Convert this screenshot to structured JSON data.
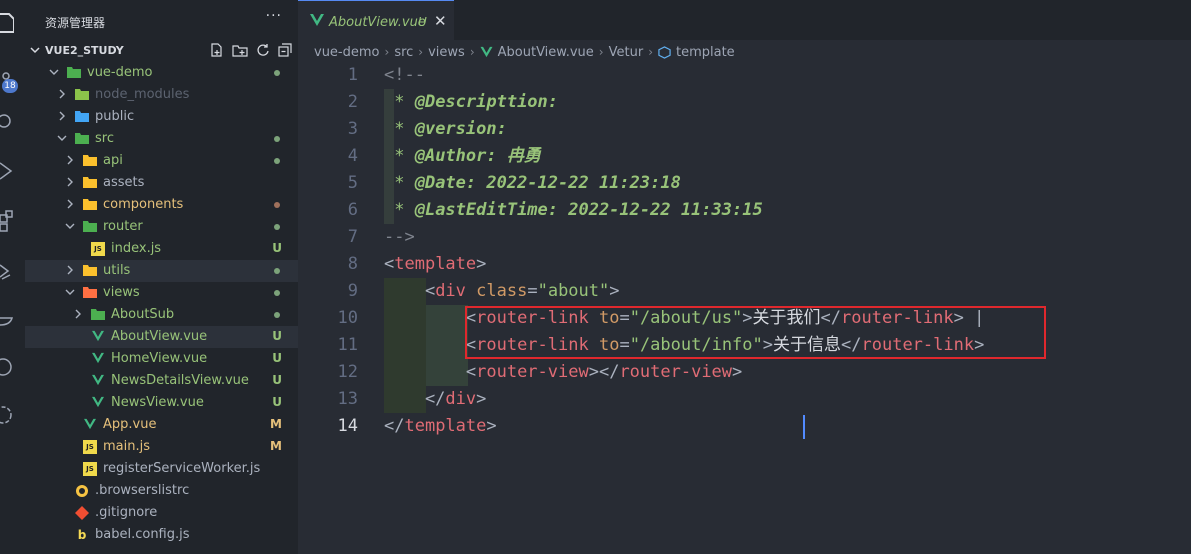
{
  "activity_bar": {
    "icons": [
      "explorer-icon",
      "source-control-icon",
      "search-icon",
      "run-debug-icon",
      "extensions-icon",
      "remote-icon",
      "docker-icon",
      "git-graph-icon",
      "openai-icon"
    ],
    "badge": "18"
  },
  "sidebar": {
    "title": "资源管理器",
    "more": "···",
    "section": "VUE2_STUDY",
    "tree": [
      {
        "label": "vue-demo",
        "type": "folder",
        "open": true,
        "depth": 0,
        "status": "",
        "dot": "#7ca37a",
        "color": "#98c379"
      },
      {
        "label": "node_modules",
        "type": "folder",
        "open": false,
        "depth": 1,
        "status": "",
        "dot": "",
        "color": "#5c6370"
      },
      {
        "label": "public",
        "type": "folder",
        "open": false,
        "depth": 1,
        "status": "",
        "dot": "",
        "color": "#abb2bf"
      },
      {
        "label": "src",
        "type": "folder",
        "open": true,
        "depth": 1,
        "status": "",
        "dot": "#7ca37a",
        "color": "#98c379"
      },
      {
        "label": "api",
        "type": "folder",
        "open": false,
        "depth": 2,
        "status": "",
        "dot": "#7ca37a",
        "color": "#98c379"
      },
      {
        "label": "assets",
        "type": "folder",
        "open": false,
        "depth": 2,
        "status": "",
        "dot": "",
        "color": "#abb2bf"
      },
      {
        "label": "components",
        "type": "folder",
        "open": false,
        "depth": 2,
        "status": "",
        "dot": "#a0715c",
        "color": "#e5c07b"
      },
      {
        "label": "router",
        "type": "folder",
        "open": true,
        "depth": 2,
        "status": "",
        "dot": "#7ca37a",
        "color": "#98c379"
      },
      {
        "label": "index.js",
        "type": "js",
        "open": false,
        "depth": 3,
        "status": "U",
        "dot": "",
        "color": "#98c379"
      },
      {
        "label": "utils",
        "type": "folder",
        "open": false,
        "depth": 2,
        "status": "",
        "dot": "#7ca37a",
        "color": "#98c379"
      },
      {
        "label": "views",
        "type": "folder",
        "open": true,
        "depth": 2,
        "status": "",
        "dot": "#7ca37a",
        "color": "#98c379"
      },
      {
        "label": "AboutSub",
        "type": "folder",
        "open": false,
        "depth": 3,
        "status": "",
        "dot": "#7ca37a",
        "color": "#98c379"
      },
      {
        "label": "AboutView.vue",
        "type": "vue",
        "open": false,
        "depth": 3,
        "status": "U",
        "dot": "",
        "color": "#98c379"
      },
      {
        "label": "HomeView.vue",
        "type": "vue",
        "open": false,
        "depth": 3,
        "status": "U",
        "dot": "",
        "color": "#98c379"
      },
      {
        "label": "NewsDetailsView.vue",
        "type": "vue",
        "open": false,
        "depth": 3,
        "status": "U",
        "dot": "",
        "color": "#98c379"
      },
      {
        "label": "NewsView.vue",
        "type": "vue",
        "open": false,
        "depth": 3,
        "status": "U",
        "dot": "",
        "color": "#98c379"
      },
      {
        "label": "App.vue",
        "type": "vue",
        "open": false,
        "depth": 2,
        "status": "M",
        "dot": "",
        "color": "#e5c07b"
      },
      {
        "label": "main.js",
        "type": "js",
        "open": false,
        "depth": 2,
        "status": "M",
        "dot": "",
        "color": "#e5c07b"
      },
      {
        "label": "registerServiceWorker.js",
        "type": "js",
        "open": false,
        "depth": 2,
        "status": "",
        "dot": "",
        "color": "#abb2bf"
      },
      {
        "label": ".browserslistrc",
        "type": "browserslist",
        "open": false,
        "depth": 1,
        "status": "",
        "dot": "",
        "color": "#abb2bf"
      },
      {
        "label": ".gitignore",
        "type": "git",
        "open": false,
        "depth": 1,
        "status": "",
        "dot": "",
        "color": "#abb2bf"
      },
      {
        "label": "babel.config.js",
        "type": "babel",
        "open": false,
        "depth": 1,
        "status": "",
        "dot": "",
        "color": "#abb2bf"
      }
    ]
  },
  "tab": {
    "name": "AboutView.vue",
    "status": "U",
    "close": "✕"
  },
  "breadcrumbs": [
    "vue-demo",
    "src",
    "views",
    "AboutView.vue",
    "Vetur",
    "template"
  ],
  "code_lines": [
    {
      "n": "1",
      "tokens": [
        [
          "cm",
          "<!--"
        ]
      ]
    },
    {
      "n": "2",
      "tokens": [
        [
          "cmg",
          " * "
        ],
        [
          "cmb",
          "@Descripttion:"
        ]
      ]
    },
    {
      "n": "3",
      "tokens": [
        [
          "cmg",
          " * "
        ],
        [
          "cmb",
          "@version:"
        ]
      ]
    },
    {
      "n": "4",
      "tokens": [
        [
          "cmg",
          " * "
        ],
        [
          "cmb",
          "@Author: 冉勇"
        ]
      ]
    },
    {
      "n": "5",
      "tokens": [
        [
          "cmg",
          " * "
        ],
        [
          "cmb",
          "@Date: 2022-12-22 11:23:18"
        ]
      ]
    },
    {
      "n": "6",
      "tokens": [
        [
          "cmg",
          " * "
        ],
        [
          "cmb",
          "@LastEditTime: 2022-12-22 11:33:15"
        ]
      ]
    },
    {
      "n": "7",
      "tokens": [
        [
          "cm",
          "-->"
        ]
      ]
    },
    {
      "n": "8",
      "tokens": [
        [
          "punc",
          "<"
        ],
        [
          "tag",
          "template"
        ],
        [
          "punc",
          ">"
        ]
      ]
    },
    {
      "n": "9",
      "tokens": [
        [
          "punc",
          "    <"
        ],
        [
          "tag",
          "div"
        ],
        [
          "punc",
          " "
        ],
        [
          "attr",
          "class"
        ],
        [
          "punc",
          "="
        ],
        [
          "str",
          "\"about\""
        ],
        [
          "punc",
          ">"
        ]
      ]
    },
    {
      "n": "10",
      "tokens": [
        [
          "punc",
          "        <"
        ],
        [
          "tag",
          "router-link"
        ],
        [
          "punc",
          " "
        ],
        [
          "attr",
          "to"
        ],
        [
          "punc",
          "="
        ],
        [
          "str",
          "\"/about/us\""
        ],
        [
          "punc",
          ">"
        ],
        [
          "txt",
          "关于我们"
        ],
        [
          "punc",
          "</"
        ],
        [
          "tag",
          "router-link"
        ],
        [
          "punc",
          "> |"
        ]
      ]
    },
    {
      "n": "11",
      "tokens": [
        [
          "punc",
          "        <"
        ],
        [
          "tag",
          "router-link"
        ],
        [
          "punc",
          " "
        ],
        [
          "attr",
          "to"
        ],
        [
          "punc",
          "="
        ],
        [
          "str",
          "\"/about/info\""
        ],
        [
          "punc",
          ">"
        ],
        [
          "txt",
          "关于信息"
        ],
        [
          "punc",
          "</"
        ],
        [
          "tag",
          "router-link"
        ],
        [
          "punc",
          ">"
        ]
      ]
    },
    {
      "n": "12",
      "tokens": [
        [
          "punc",
          "        <"
        ],
        [
          "tag",
          "router-view"
        ],
        [
          "punc",
          "></"
        ],
        [
          "tag",
          "router-view"
        ],
        [
          "punc",
          ">"
        ]
      ]
    },
    {
      "n": "13",
      "tokens": [
        [
          "punc",
          "    </"
        ],
        [
          "tag",
          "div"
        ],
        [
          "punc",
          ">"
        ]
      ]
    },
    {
      "n": "14",
      "tokens": [
        [
          "punc",
          "</"
        ],
        [
          "tag",
          "template"
        ],
        [
          "punc",
          ">"
        ]
      ]
    }
  ],
  "colors": {
    "accent": "#568af2",
    "highlight_box": "#e0282d",
    "vue_green": "#41b883"
  }
}
